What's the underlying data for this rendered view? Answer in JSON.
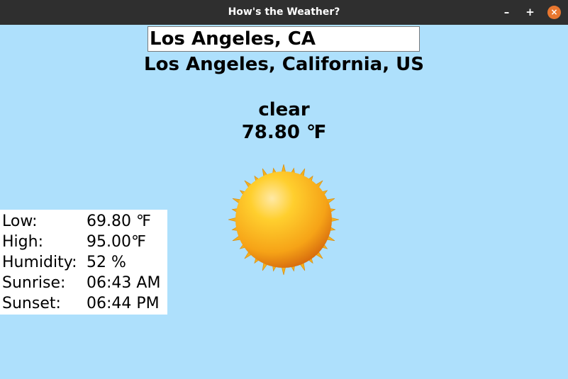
{
  "window": {
    "title": "How's the Weather?",
    "minimize_label": "–",
    "maximize_label": "+",
    "close_label": "×"
  },
  "search": {
    "value": "Los Angeles, CA"
  },
  "weather": {
    "location": "Los Angeles, California, US",
    "condition": "clear",
    "temperature": "78.80 ℉",
    "icon": "sun-icon"
  },
  "details": [
    {
      "label": "Low:",
      "value": "69.80 ℉"
    },
    {
      "label": "High:",
      "value": "95.00℉"
    },
    {
      "label": "Humidity:",
      "value": "52 %"
    },
    {
      "label": "Sunrise:",
      "value": "06:43 AM"
    },
    {
      "label": "Sunset:",
      "value": "06:44 PM"
    }
  ],
  "colors": {
    "background": "#aee0fc",
    "titlebar": "#2f2f2f",
    "close_button": "#e9772f"
  }
}
